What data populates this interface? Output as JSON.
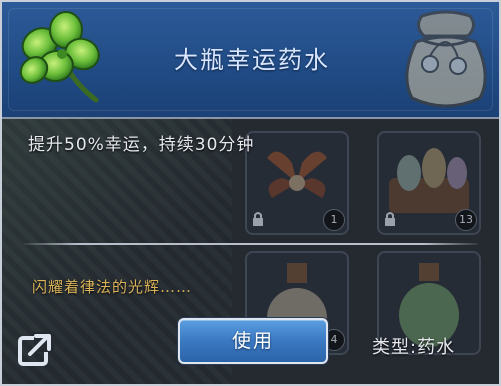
{
  "item": {
    "name": "大瓶幸运药水",
    "description": "提升50%幸运，持续30分钟",
    "flavor_text": "闪耀着律法的光辉……",
    "type_label": "类型:药水",
    "icon": "four-leaf-clover-icon"
  },
  "actions": {
    "use_label": "使用",
    "share_icon": "share-icon"
  },
  "background_slots": [
    {
      "icon": "crystal-flower-icon",
      "count": "1",
      "locked": true
    },
    {
      "icon": "potion-rack-icon",
      "count": "13",
      "locked": true
    },
    {
      "icon": "potion-bottle-icon",
      "count": "4",
      "locked": false
    },
    {
      "icon": "green-potion-icon",
      "count": "",
      "locked": false
    }
  ],
  "colors": {
    "header_bg": "#214c86",
    "title": "#d8e6ff",
    "flavor": "#d9b25a",
    "button": "#3a79c2",
    "panel_bg": "#252a31"
  }
}
